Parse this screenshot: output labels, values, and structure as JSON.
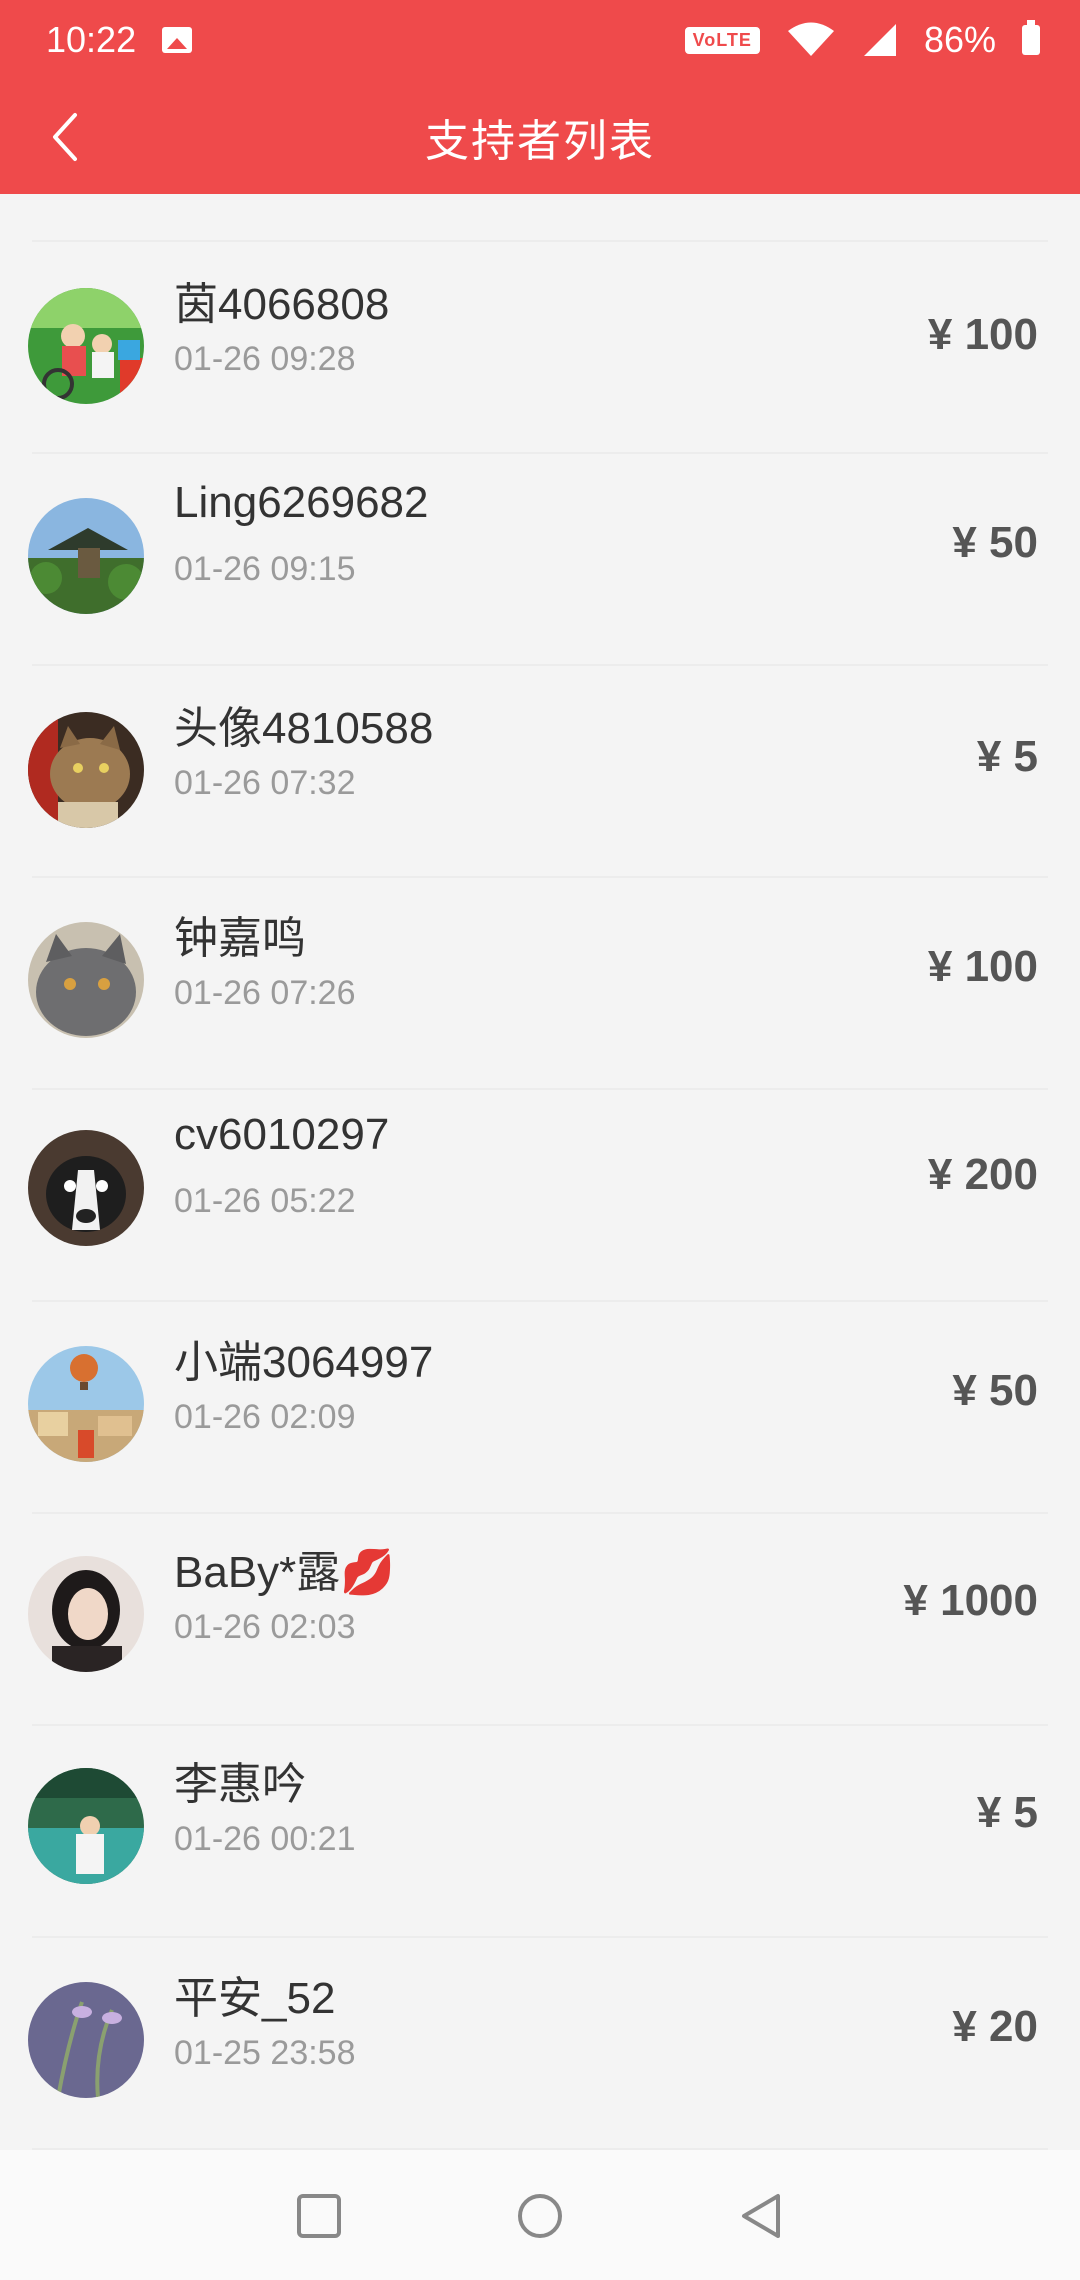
{
  "status_bar": {
    "time": "10:22",
    "volte": "VoLTE",
    "battery": "86%"
  },
  "header": {
    "title": "支持者列表"
  },
  "colors": {
    "brand_red": "#ef4a4b"
  },
  "supporters": [
    {
      "name": "茵4066808",
      "time": "01-26 09:28",
      "amount": "¥ 100",
      "avatar": "children-bicycle-photo"
    },
    {
      "name": "Ling6269682",
      "time": "01-26 09:15",
      "amount": "¥ 50",
      "avatar": "pagoda-sky-photo"
    },
    {
      "name": "头像4810588",
      "time": "01-26 07:32",
      "amount": "¥ 5",
      "avatar": "tabby-cat-photo"
    },
    {
      "name": "钟嘉鸣",
      "time": "01-26 07:26",
      "amount": "¥ 100",
      "avatar": "gray-cat-photo"
    },
    {
      "name": "cv6010297",
      "time": "01-26 05:22",
      "amount": "¥ 200",
      "avatar": "dog-photo"
    },
    {
      "name": "小端3064997",
      "time": "01-26 02:09",
      "amount": "¥ 50",
      "avatar": "hot-air-balloon-photo"
    },
    {
      "name": "BaBy*露💋",
      "time": "01-26 02:03",
      "amount": "¥ 1000",
      "avatar": "woman-portrait-photo"
    },
    {
      "name": "李惠吟",
      "time": "01-26 00:21",
      "amount": "¥ 5",
      "avatar": "lake-person-photo"
    },
    {
      "name": "平安_52",
      "time": "01-25 23:58",
      "amount": "¥ 20",
      "avatar": "flower-photo"
    }
  ],
  "system_nav": {
    "recents": "square-icon",
    "home": "circle-icon",
    "back": "triangle-back-icon"
  }
}
